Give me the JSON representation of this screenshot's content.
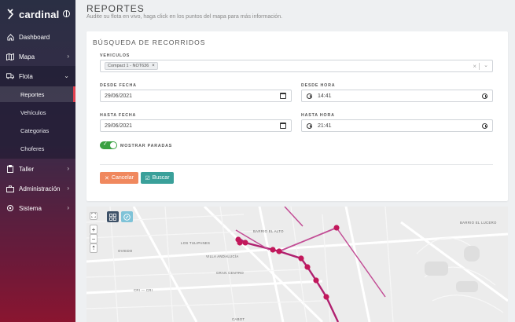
{
  "brand": {
    "name": "cardinal"
  },
  "sidebar": {
    "items": [
      {
        "label": "Dashboard",
        "icon": "home-icon"
      },
      {
        "label": "Mapa",
        "icon": "map-icon"
      },
      {
        "label": "Flota",
        "icon": "truck-icon"
      },
      {
        "label": "Taller",
        "icon": "clipboard-icon"
      },
      {
        "label": "Administración",
        "icon": "briefcase-icon"
      },
      {
        "label": "Sistema",
        "icon": "settings-icon"
      }
    ],
    "flota_sub": [
      "Reportes",
      "Vehículos",
      "Categorias",
      "Choferes"
    ]
  },
  "page": {
    "title": "REPORTES",
    "subtitle": "Audite su flota en vivo, haga click en los puntos del mapa para más información."
  },
  "form": {
    "title": "BÚSQUEDA DE RECORRIDOS",
    "vehiculos_label": "VEHICULOS",
    "vehiculo_chip": "Compact 1 - NOT636",
    "chip_remove": "×",
    "clear_symbol": "×",
    "caret_symbol": "⌄",
    "desde_fecha_label": "DESDE FECHA",
    "desde_fecha": "29/06/2021",
    "desde_hora_label": "DESDE HORA",
    "desde_hora": "14:41",
    "hasta_fecha_label": "HASTA FECHA",
    "hasta_fecha": "29/06/2021",
    "hasta_hora_label": "HASTA HORA",
    "hasta_hora": "21:41",
    "mostrar_paradas_label": "MOSTRAR PARADAS",
    "mostrar_paradas_on": true,
    "cancel_label": "Cancelar",
    "search_label": "Buscar"
  },
  "map": {
    "zoom_in": "+",
    "zoom_out": "−",
    "labels": [
      "BARRIO EL ALTO",
      "LOS TULIPANES",
      "OVIEDO",
      "VILLA ANDALUCÍA",
      "GRAN CENTRO",
      "CRI — CRI",
      "CABOT",
      "BARRIO EL LUCERO"
    ],
    "route_color": "#b0206f"
  }
}
